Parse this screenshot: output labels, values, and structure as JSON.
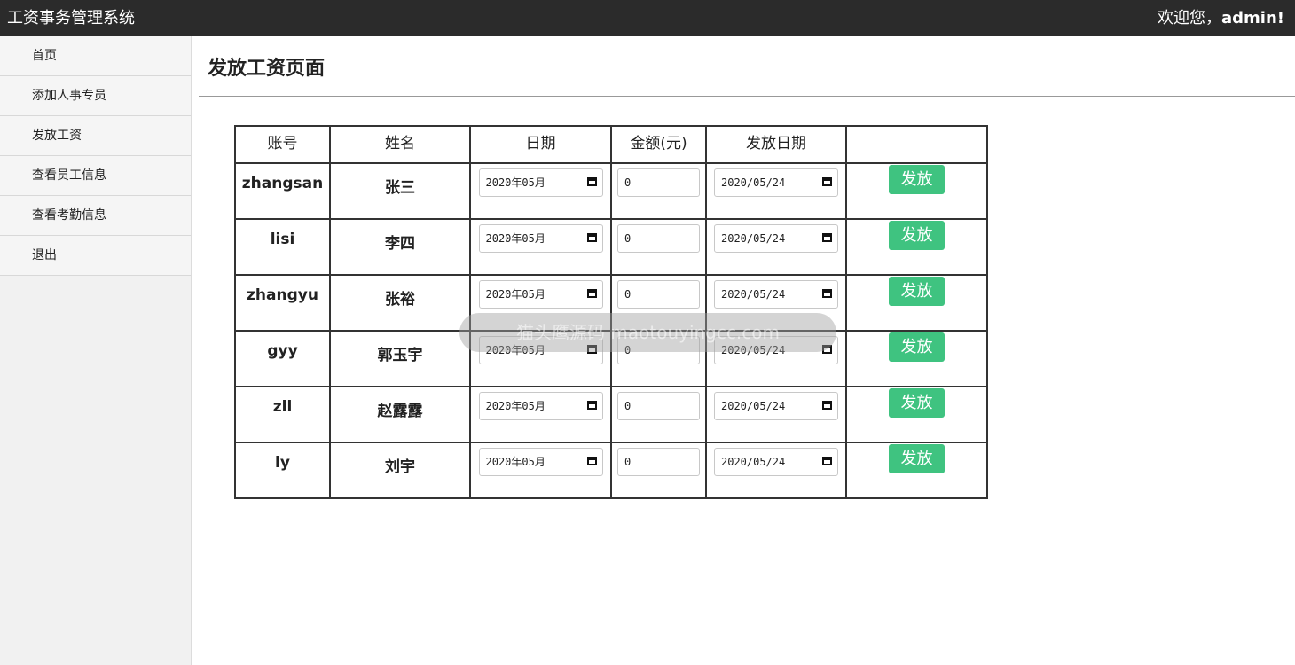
{
  "header": {
    "app_title": "工资事务管理系统",
    "welcome_prefix": "欢迎您，",
    "username": "admin!"
  },
  "sidebar": {
    "items": [
      {
        "label": "首页"
      },
      {
        "label": "添加人事专员"
      },
      {
        "label": "发放工资"
      },
      {
        "label": "查看员工信息"
      },
      {
        "label": "查看考勤信息"
      },
      {
        "label": "退出"
      }
    ]
  },
  "main": {
    "page_title": "发放工资页面",
    "table": {
      "headers": [
        "账号",
        "姓名",
        "日期",
        "金额(元)",
        "发放日期",
        ""
      ],
      "pay_button_label": "发放",
      "rows": [
        {
          "account": "zhangsan",
          "name": "张三",
          "date": "2020年05月",
          "amount": "0",
          "pay_date": "2020/05/24"
        },
        {
          "account": "lisi",
          "name": "李四",
          "date": "2020年05月",
          "amount": "0",
          "pay_date": "2020/05/24"
        },
        {
          "account": "zhangyu",
          "name": "张裕",
          "date": "2020年05月",
          "amount": "0",
          "pay_date": "2020/05/24"
        },
        {
          "account": "gyy",
          "name": "郭玉宇",
          "date": "2020年05月",
          "amount": "0",
          "pay_date": "2020/05/24"
        },
        {
          "account": "zll",
          "name": "赵露露",
          "date": "2020年05月",
          "amount": "0",
          "pay_date": "2020/05/24"
        },
        {
          "account": "ly",
          "name": "刘宇",
          "date": "2020年05月",
          "amount": "0",
          "pay_date": "2020/05/24"
        }
      ]
    }
  },
  "watermark": "猫头鹰源码 maotouyingcc.com",
  "colors": {
    "topbar": "#2b2b2b",
    "pay_button": "#3fc380",
    "sidebar": "#f1f1f1"
  }
}
